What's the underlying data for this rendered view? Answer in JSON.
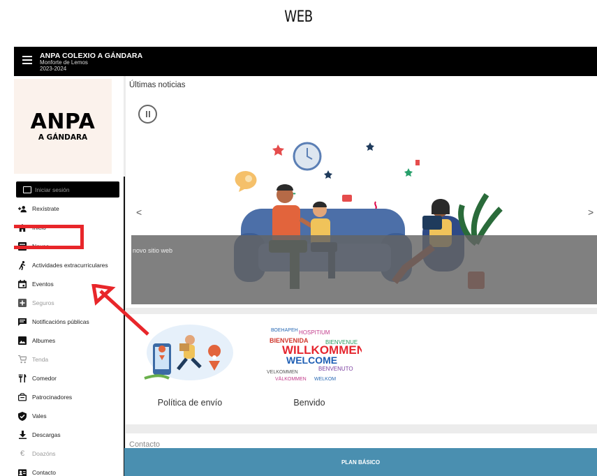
{
  "caption": "WEB",
  "app": {
    "title": "ANPA COLEXIO A GÁNDARA",
    "subtitle": "Monforte de Lemos",
    "year": "2023-2024"
  },
  "logo": {
    "big": "ANPA",
    "small": "A GÁNDARA"
  },
  "login": {
    "label": "Iniciar sesión"
  },
  "nav": [
    {
      "label": "Rexístrate",
      "icon": "add-user-icon",
      "disabled": false
    },
    {
      "label": "Inicio",
      "icon": "home-icon",
      "disabled": false
    },
    {
      "label": "Novas",
      "icon": "news-icon",
      "disabled": false
    },
    {
      "label": "Actividades extracurriculares",
      "icon": "run-icon",
      "disabled": false
    },
    {
      "label": "Eventos",
      "icon": "calendar-icon",
      "disabled": false
    },
    {
      "label": "Seguros",
      "icon": "plus-box-icon",
      "disabled": true
    },
    {
      "label": "Notificacións públicas",
      "icon": "message-icon",
      "disabled": false
    },
    {
      "label": "Albumes",
      "icon": "image-icon",
      "disabled": false
    },
    {
      "label": "Tenda",
      "icon": "cart-icon",
      "disabled": true
    },
    {
      "label": "Comedor",
      "icon": "cutlery-icon",
      "disabled": false
    },
    {
      "label": "Patrocinadores",
      "icon": "sponsor-icon",
      "disabled": false
    },
    {
      "label": "Vales",
      "icon": "shield-check-icon",
      "disabled": false
    },
    {
      "label": "Descargas",
      "icon": "download-icon",
      "disabled": false
    },
    {
      "label": "Doazóns",
      "icon": "euro-icon",
      "disabled": true
    },
    {
      "label": "Contacto",
      "icon": "contact-card-icon",
      "disabled": false
    }
  ],
  "news": {
    "title": "Últimas noticias",
    "slide_caption": "novo sitio web",
    "prev": "<",
    "next": ">"
  },
  "cards": [
    {
      "label": "Política de envío",
      "icon": "delivery-illustration"
    },
    {
      "label": "Benvido",
      "icon": "welcome-word-cloud"
    }
  ],
  "welcome_words": [
    "WILLKOMMEN",
    "WELCOME",
    "BIENVENIDA",
    "BENVENUTO",
    "BIENVENUE",
    "VELKOMMEN",
    "VÄLKOMMEN",
    "WELKOM",
    "ВОЕНАРЕН",
    "HOSPITIUM"
  ],
  "contact": {
    "title": "Contacto"
  },
  "plan": {
    "label": "PLAN BÁSICO"
  },
  "colors": {
    "topbar": "#000000",
    "accent": "#4a8fb0",
    "highlight": "#e8262a",
    "logo_bg": "#fbf2ec"
  }
}
